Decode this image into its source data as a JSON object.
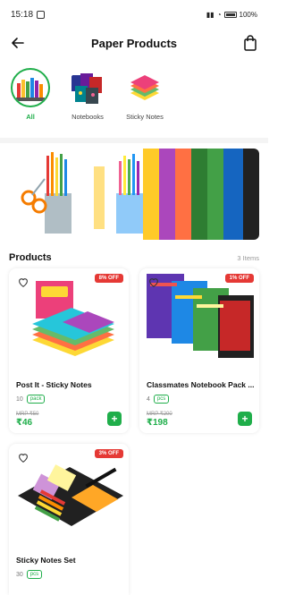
{
  "status_bar": {
    "time": "15:18",
    "battery": "100%"
  },
  "header": {
    "title": "Paper Products"
  },
  "categories": [
    {
      "label": "All",
      "active": true
    },
    {
      "label": "Notebooks",
      "active": false
    },
    {
      "label": "Sticky Notes",
      "active": false
    }
  ],
  "products_section": {
    "title": "Products",
    "count": "3 Items"
  },
  "products": [
    {
      "name": "Post It - Sticky Notes",
      "qty": "10",
      "unit": "pack",
      "mrp": "MRP ₹50",
      "price": "₹46",
      "discount": "8% OFF",
      "add_label": "+"
    },
    {
      "name": "Classmates Notebook Pack ...",
      "qty": "4",
      "unit": "pcs",
      "mrp": "MRP ₹200",
      "price": "₹198",
      "discount": "1% OFF",
      "add_label": "+"
    },
    {
      "name": "Sticky Notes Set",
      "qty": "30",
      "unit": "pcs",
      "mrp": "",
      "price": "",
      "discount": "3% OFF",
      "add_label": ""
    }
  ],
  "colors": {
    "accent": "#1fae4a",
    "discount": "#e53935"
  },
  "icons": [
    "back-arrow-icon",
    "shopping-bag-icon",
    "heart-icon",
    "plus-icon"
  ]
}
